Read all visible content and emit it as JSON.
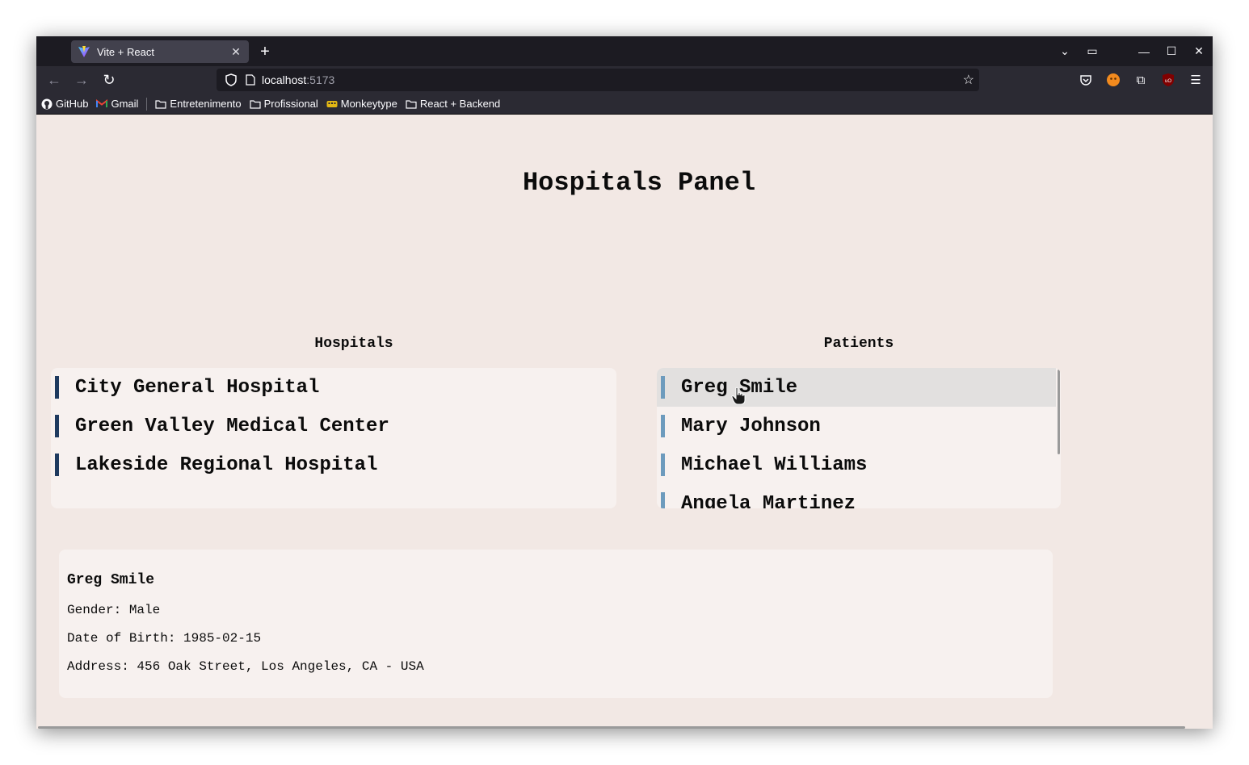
{
  "browser": {
    "tab_title": "Vite + React",
    "url_host": "localhost",
    "url_port": ":5173",
    "bookmarks": [
      {
        "label": "GitHub",
        "icon": "github-icon"
      },
      {
        "label": "Gmail",
        "icon": "gmail-icon"
      },
      {
        "label": "Entretenimento",
        "icon": "folder-icon"
      },
      {
        "label": "Profissional",
        "icon": "folder-icon"
      },
      {
        "label": "Monkeytype",
        "icon": "monkeytype-icon"
      },
      {
        "label": "React + Backend",
        "icon": "folder-icon"
      }
    ]
  },
  "page": {
    "title": "Hospitals Panel",
    "hospitals_heading": "Hospitals",
    "patients_heading": "Patients",
    "hospitals": [
      "City General Hospital",
      "Green Valley Medical Center",
      "Lakeside Regional Hospital"
    ],
    "patients": [
      "Greg Smile",
      "Mary Johnson",
      "Michael Williams",
      "Angela Martinez"
    ],
    "selected_patient": {
      "name": "Greg Smile",
      "gender": "Gender: Male",
      "dob": "Date of Birth: 1985-02-15",
      "address": "Address: 456 Oak Street, Los Angeles, CA - USA"
    }
  },
  "colors": {
    "page_bg": "#f2e8e4",
    "panel_bg": "#f7f1ef",
    "hospital_bar": "#1e3a5f",
    "patient_bar": "#6d9bbd",
    "selected_row": "#e2e0df"
  }
}
